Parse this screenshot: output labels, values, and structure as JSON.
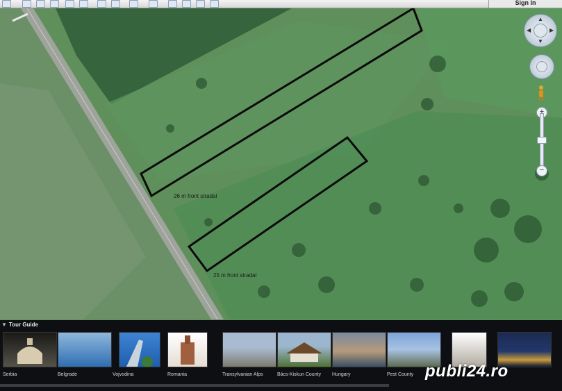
{
  "header": {
    "sign_in_label": "Sign In"
  },
  "map": {
    "labels": {
      "front_1": "26 m front stradal",
      "front_2": "25 m front stradal"
    }
  },
  "navigation": {
    "zoom_in": "+",
    "zoom_out": "−"
  },
  "tour_guide": {
    "title": "Tour Guide",
    "items": [
      {
        "label": "Serbia",
        "color": "#3b3a34"
      },
      {
        "label": "Belgrade",
        "color": "#4a86c4"
      },
      {
        "label": "Vojvodina",
        "color": "#2f6fbd"
      },
      {
        "label": "Romania",
        "color": "#a36a4a"
      },
      {
        "label": "Transylvanian Alps",
        "color": "#8796a3"
      },
      {
        "label": "Bács-Kiskun County",
        "color": "#6e8d52"
      },
      {
        "label": "Hungary",
        "color": "#6a7c8e"
      },
      {
        "label": "Pest County",
        "color": "#7e95b4"
      },
      {
        "label": "",
        "color": "#c8c6c0"
      },
      {
        "label": "",
        "color": "#1c2a4f"
      }
    ]
  },
  "watermark": "publi24.ro"
}
